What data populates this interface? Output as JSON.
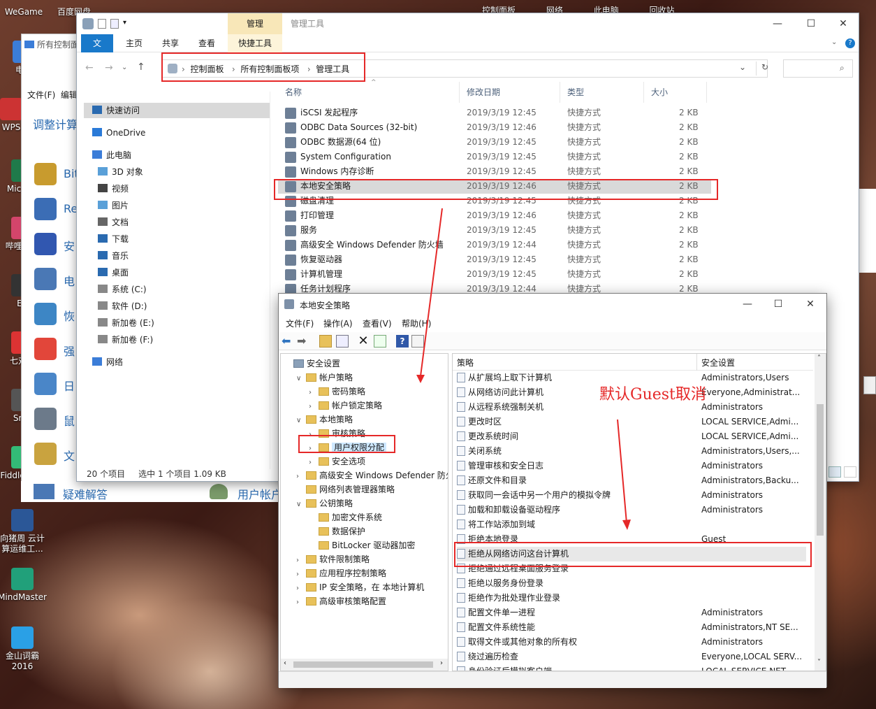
{
  "desktop": {
    "icons": [
      {
        "label": "WeGame",
        "color": "#d33"
      },
      {
        "label": "百度网盘",
        "color": "#2f8df5"
      },
      {
        "label": "电脑",
        "color": "#3b7dd8"
      },
      {
        "label": "WPS",
        "color": "#c33"
      },
      {
        "label": "Micr Ed",
        "color": "#1f7a4a"
      },
      {
        "label": "哔哩哔 U",
        "color": "#d3456b"
      },
      {
        "label": "EV",
        "color": "#333"
      },
      {
        "label": "七对工",
        "color": "#d33"
      },
      {
        "label": "Snip",
        "color": "#555"
      },
      {
        "label": "Fiddle 快捷",
        "color": "#3b7"
      },
      {
        "label": "向猪周 云计算运维工...",
        "color": "#2b5797"
      },
      {
        "label": "MindMaster",
        "color": "#21a07a"
      },
      {
        "label": "金山词霸 2016",
        "color": "#2aa0e6"
      }
    ],
    "top_labels": [
      "控制面板",
      "网络",
      "此电脑",
      "回收站"
    ]
  },
  "control_panel": {
    "title": "所有控制面",
    "menu": [
      "文件(F)",
      "编辑"
    ],
    "heading": "调整计算",
    "items": [
      "Bit",
      "Re",
      "安",
      "电",
      "恢",
      "强",
      "日",
      "鼠",
      "文"
    ],
    "bottom": [
      "疑难解答",
      "用户帐户"
    ]
  },
  "explorer": {
    "title_tab": "管理",
    "context_tab": "管理工具",
    "tabs": [
      "文件",
      "主页",
      "共享",
      "查看",
      "快捷工具"
    ],
    "breadcrumb": [
      "控制面板",
      "所有控制面板项",
      "管理工具"
    ],
    "search_placeholder": "",
    "sidebar": [
      {
        "label": "快速访问",
        "level": 0,
        "sel": true
      },
      {
        "label": "OneDrive",
        "level": 0
      },
      {
        "label": "此电脑",
        "level": 0
      },
      {
        "label": "3D 对象",
        "level": 1
      },
      {
        "label": "视频",
        "level": 1
      },
      {
        "label": "图片",
        "level": 1
      },
      {
        "label": "文档",
        "level": 1
      },
      {
        "label": "下载",
        "level": 1
      },
      {
        "label": "音乐",
        "level": 1
      },
      {
        "label": "桌面",
        "level": 1
      },
      {
        "label": "系统 (C:)",
        "level": 1
      },
      {
        "label": "软件 (D:)",
        "level": 1
      },
      {
        "label": "新加卷 (E:)",
        "level": 1
      },
      {
        "label": "新加卷 (F:)",
        "level": 1
      },
      {
        "label": "网络",
        "level": 0
      }
    ],
    "columns": [
      "名称",
      "修改日期",
      "类型",
      "大小"
    ],
    "files": [
      {
        "name": "iSCSI 发起程序",
        "date": "2019/3/19 12:45",
        "type": "快捷方式",
        "size": "2 KB"
      },
      {
        "name": "ODBC Data Sources (32-bit)",
        "date": "2019/3/19 12:46",
        "type": "快捷方式",
        "size": "2 KB"
      },
      {
        "name": "ODBC 数据源(64 位)",
        "date": "2019/3/19 12:45",
        "type": "快捷方式",
        "size": "2 KB"
      },
      {
        "name": "System Configuration",
        "date": "2019/3/19 12:45",
        "type": "快捷方式",
        "size": "2 KB"
      },
      {
        "name": "Windows 内存诊断",
        "date": "2019/3/19 12:45",
        "type": "快捷方式",
        "size": "2 KB"
      },
      {
        "name": "本地安全策略",
        "date": "2019/3/19 12:46",
        "type": "快捷方式",
        "size": "2 KB",
        "sel": true
      },
      {
        "name": "磁盘清理",
        "date": "2019/3/19 12:45",
        "type": "快捷方式",
        "size": "2 KB"
      },
      {
        "name": "打印管理",
        "date": "2019/3/19 12:46",
        "type": "快捷方式",
        "size": "2 KB"
      },
      {
        "name": "服务",
        "date": "2019/3/19 12:45",
        "type": "快捷方式",
        "size": "2 KB"
      },
      {
        "name": "高级安全 Windows Defender 防火墙",
        "date": "2019/3/19 12:44",
        "type": "快捷方式",
        "size": "2 KB"
      },
      {
        "name": "恢复驱动器",
        "date": "2019/3/19 12:45",
        "type": "快捷方式",
        "size": "2 KB"
      },
      {
        "name": "计算机管理",
        "date": "2019/3/19 12:45",
        "type": "快捷方式",
        "size": "2 KB"
      },
      {
        "name": "任务计划程序",
        "date": "2019/3/19 12:44",
        "type": "快捷方式",
        "size": "2 KB"
      }
    ],
    "status": {
      "count": "20 个项目",
      "selected": "选中 1 个项目  1.09 KB"
    }
  },
  "secpol": {
    "title": "本地安全策略",
    "menu": [
      "文件(F)",
      "操作(A)",
      "查看(V)",
      "帮助(H)"
    ],
    "tree": [
      {
        "label": "安全设置",
        "lvl": 0,
        "arrow": ""
      },
      {
        "label": "帐户策略",
        "lvl": 1,
        "arrow": "∨"
      },
      {
        "label": "密码策略",
        "lvl": 2,
        "arrow": "›"
      },
      {
        "label": "帐户锁定策略",
        "lvl": 2,
        "arrow": "›"
      },
      {
        "label": "本地策略",
        "lvl": 1,
        "arrow": "∨"
      },
      {
        "label": "审核策略",
        "lvl": 2,
        "arrow": "›"
      },
      {
        "label": "用户权限分配",
        "lvl": 2,
        "arrow": "›",
        "sel": true
      },
      {
        "label": "安全选项",
        "lvl": 2,
        "arrow": "›"
      },
      {
        "label": "高级安全 Windows Defender 防火墙",
        "lvl": 1,
        "arrow": "›"
      },
      {
        "label": "网络列表管理器策略",
        "lvl": 1,
        "arrow": ""
      },
      {
        "label": "公钥策略",
        "lvl": 1,
        "arrow": "∨"
      },
      {
        "label": "加密文件系统",
        "lvl": 2,
        "arrow": ""
      },
      {
        "label": "数据保护",
        "lvl": 2,
        "arrow": ""
      },
      {
        "label": "BitLocker 驱动器加密",
        "lvl": 2,
        "arrow": ""
      },
      {
        "label": "软件限制策略",
        "lvl": 1,
        "arrow": "›"
      },
      {
        "label": "应用程序控制策略",
        "lvl": 1,
        "arrow": "›"
      },
      {
        "label": "IP 安全策略，在 本地计算机",
        "lvl": 1,
        "arrow": "›"
      },
      {
        "label": "高级审核策略配置",
        "lvl": 1,
        "arrow": "›"
      }
    ],
    "columns": [
      "策略",
      "安全设置"
    ],
    "policies": [
      {
        "p": "从扩展坞上取下计算机",
        "s": "Administrators,Users"
      },
      {
        "p": "从网络访问此计算机",
        "s": "Everyone,Administrat..."
      },
      {
        "p": "从远程系统强制关机",
        "s": "Administrators"
      },
      {
        "p": "更改时区",
        "s": "LOCAL SERVICE,Admi..."
      },
      {
        "p": "更改系统时间",
        "s": "LOCAL SERVICE,Admi..."
      },
      {
        "p": "关闭系统",
        "s": "Administrators,Users,..."
      },
      {
        "p": "管理审核和安全日志",
        "s": "Administrators"
      },
      {
        "p": "还原文件和目录",
        "s": "Administrators,Backu..."
      },
      {
        "p": "获取同一会话中另一个用户的模拟令牌",
        "s": "Administrators"
      },
      {
        "p": "加载和卸载设备驱动程序",
        "s": "Administrators"
      },
      {
        "p": "将工作站添加到域",
        "s": ""
      },
      {
        "p": "拒绝本地登录",
        "s": "Guest"
      },
      {
        "p": "拒绝从网络访问这台计算机",
        "s": "",
        "sel": true
      },
      {
        "p": "拒绝通过远程桌面服务登录",
        "s": ""
      },
      {
        "p": "拒绝以服务身份登录",
        "s": ""
      },
      {
        "p": "拒绝作为批处理作业登录",
        "s": ""
      },
      {
        "p": "配置文件单一进程",
        "s": "Administrators"
      },
      {
        "p": "配置文件系统性能",
        "s": "Administrators,NT SE..."
      },
      {
        "p": "取得文件或其他对象的所有权",
        "s": "Administrators"
      },
      {
        "p": "绕过遍历检查",
        "s": "Everyone,LOCAL SERV..."
      },
      {
        "p": "身份验证后模拟客户端",
        "s": "LOCAL SERVICE,NET..."
      }
    ]
  },
  "annotation": "默认Guest取消",
  "colors": {
    "highlight": "#e52828",
    "accent": "#1979ca"
  }
}
